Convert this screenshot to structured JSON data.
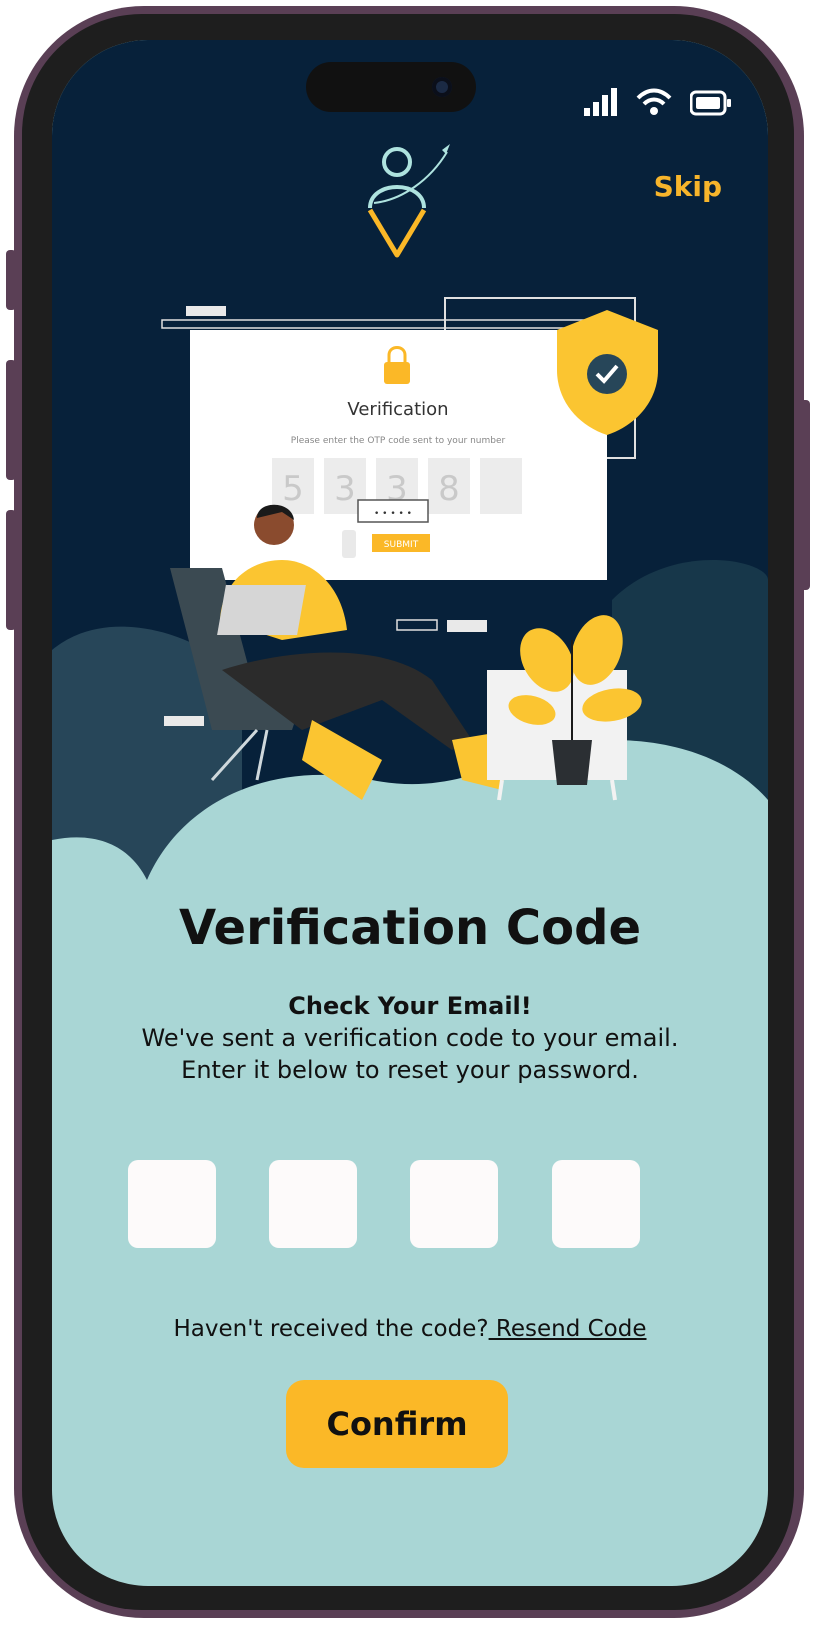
{
  "header": {
    "skip_label": "Skip"
  },
  "illustration": {
    "card_title": "Verification",
    "card_subtitle": "Please enter the OTP code sent to your number",
    "card_digits": [
      "5",
      "3",
      "3",
      "8",
      ""
    ],
    "submit_label": "SUBMIT",
    "password_mask": "• • • • •"
  },
  "main": {
    "title": "Verification Code",
    "heading": "Check Your Email!",
    "line1": "We've sent a verification code to your email.",
    "line2": "Enter it below to reset your password."
  },
  "otp": {
    "values": [
      "",
      "",
      "",
      ""
    ]
  },
  "resend": {
    "prompt": "Haven't received the code?",
    "link": " Resend Code"
  },
  "confirm_label": "Confirm",
  "colors": {
    "accent": "#fbb827",
    "dark_bg": "#07213a",
    "screen_bg": "#a9d6d5"
  }
}
